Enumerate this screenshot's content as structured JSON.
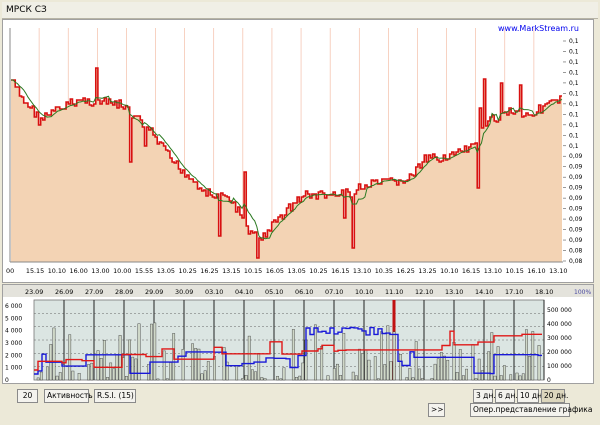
{
  "window": {
    "title": "МРСК СЗ"
  },
  "chart": {
    "brand": "www.MarkStream.ru",
    "y_ticks": [
      "0,1",
      "0,1",
      "0,1",
      "0,1",
      "0,1",
      "0,1",
      "0,1",
      "0,1",
      "0,1",
      "0,1",
      "0,1",
      "0,09",
      "0,09",
      "0,09",
      "0,09",
      "0,09",
      "0,09",
      "0,09",
      "0,09",
      "0,09",
      "0,08",
      "0,08"
    ],
    "x_ticks": [
      "00",
      "15.15",
      "10.10",
      "16.00",
      "13.00",
      "10.00",
      "15.55",
      "13.05",
      "10.25",
      "16.25",
      "13.15",
      "10.15",
      "16.05",
      "13.05",
      "10.25",
      "16.15",
      "13.10",
      "10.35",
      "16.25",
      "13.25",
      "10.10",
      "16.15",
      "13.10",
      "10.15",
      "16.10",
      "13.10"
    ]
  },
  "volume": {
    "dates": [
      "23.09",
      "26.09",
      "27.09",
      "28.09",
      "29.09",
      "30.09",
      "03.10",
      "04.10",
      "05.10",
      "06.10",
      "07.10",
      "10.10",
      "11.10",
      "12.10",
      "13.10",
      "14.10",
      "17.10",
      "18.10"
    ],
    "left_ticks": [
      "6 000",
      "5 000",
      "4 000",
      "3 000",
      "2 000",
      "1 000",
      "0"
    ],
    "right_ticks": [
      "500 000",
      "400 000",
      "300 000",
      "200 000",
      "100 000",
      "0"
    ],
    "percent_label": "100%"
  },
  "controls": {
    "period": "20",
    "activity": "Активность",
    "rsi": "R.S.I. (15)",
    "scroll": ">>",
    "range_3": "3 дн.",
    "range_6": "6 дн.",
    "range_10": "10 дн.",
    "range_20": "20 дн.",
    "oper": "Опер.представление графика"
  },
  "colors": {
    "price_fill": "#f3d3b4",
    "price_line": "#d81010",
    "ma_line": "#2c7a22",
    "volume_blue": "#1818d8",
    "volume_red": "#e01818"
  }
}
